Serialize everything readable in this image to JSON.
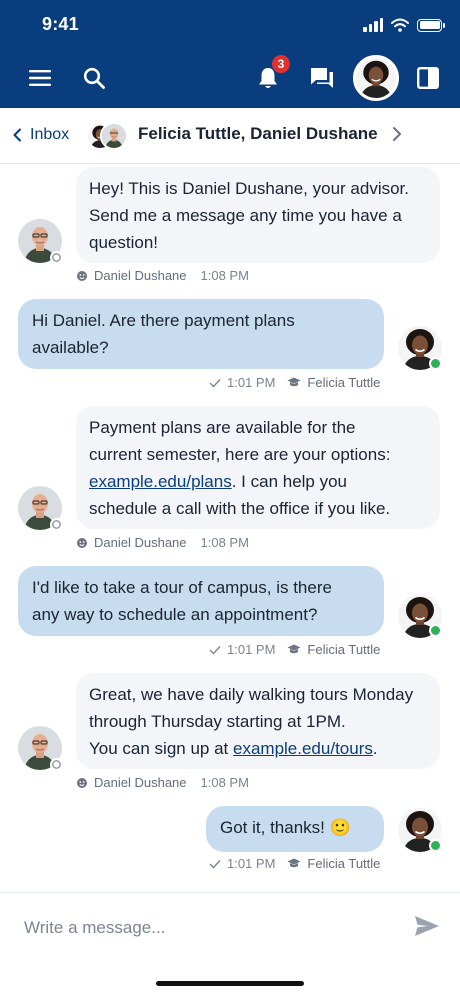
{
  "status_bar": {
    "time": "9:41"
  },
  "app_bar": {
    "notification_count": "3"
  },
  "conversation": {
    "back_label": "Inbox",
    "title": "Felicia Tuttle, Daniel Dushane"
  },
  "messages": [
    {
      "direction": "incoming",
      "lines": [
        "Hey! This is Daniel Dushane, your advisor.",
        "Send me a message any time you have a",
        "question!"
      ],
      "sender": "Daniel Dushane",
      "time": "1:08 PM"
    },
    {
      "direction": "outgoing",
      "lines": [
        "Hi Daniel. Are there payment plans",
        "available?"
      ],
      "sender": "Felicia Tuttle",
      "time": "1:01 PM"
    },
    {
      "direction": "incoming",
      "line1": "Payment plans are available for the",
      "line2": "current semester, here are your options:",
      "link": "example.edu/plans",
      "line3_rest": ". I can help you",
      "line4": "schedule a call with the office if you like.",
      "sender": "Daniel Dushane",
      "time": "1:08 PM"
    },
    {
      "direction": "outgoing",
      "lines": [
        "I'd like to take a tour of campus, is there",
        "any way to schedule an appointment?"
      ],
      "sender": "Felicia Tuttle",
      "time": "1:01 PM"
    },
    {
      "direction": "incoming",
      "line1": "Great, we have daily walking tours Monday",
      "line2": "through Thursday starting at 1PM.",
      "line3_pre": "You can sign up at ",
      "link": "example.edu/tours",
      "line3_post": ".",
      "sender": "Daniel Dushane",
      "time": "1:08 PM"
    },
    {
      "direction": "outgoing",
      "text": "Got it, thanks!",
      "emoji": "🙂",
      "sender": "Felicia Tuttle",
      "time": "1:01 PM"
    }
  ],
  "composer": {
    "placeholder": "Write a message..."
  },
  "colors": {
    "header_blue": "#0a3d7d",
    "outgoing_bubble": "#c7dcee",
    "incoming_bubble": "#f3f5f8",
    "online": "#2fb15a",
    "badge": "#e03131"
  }
}
